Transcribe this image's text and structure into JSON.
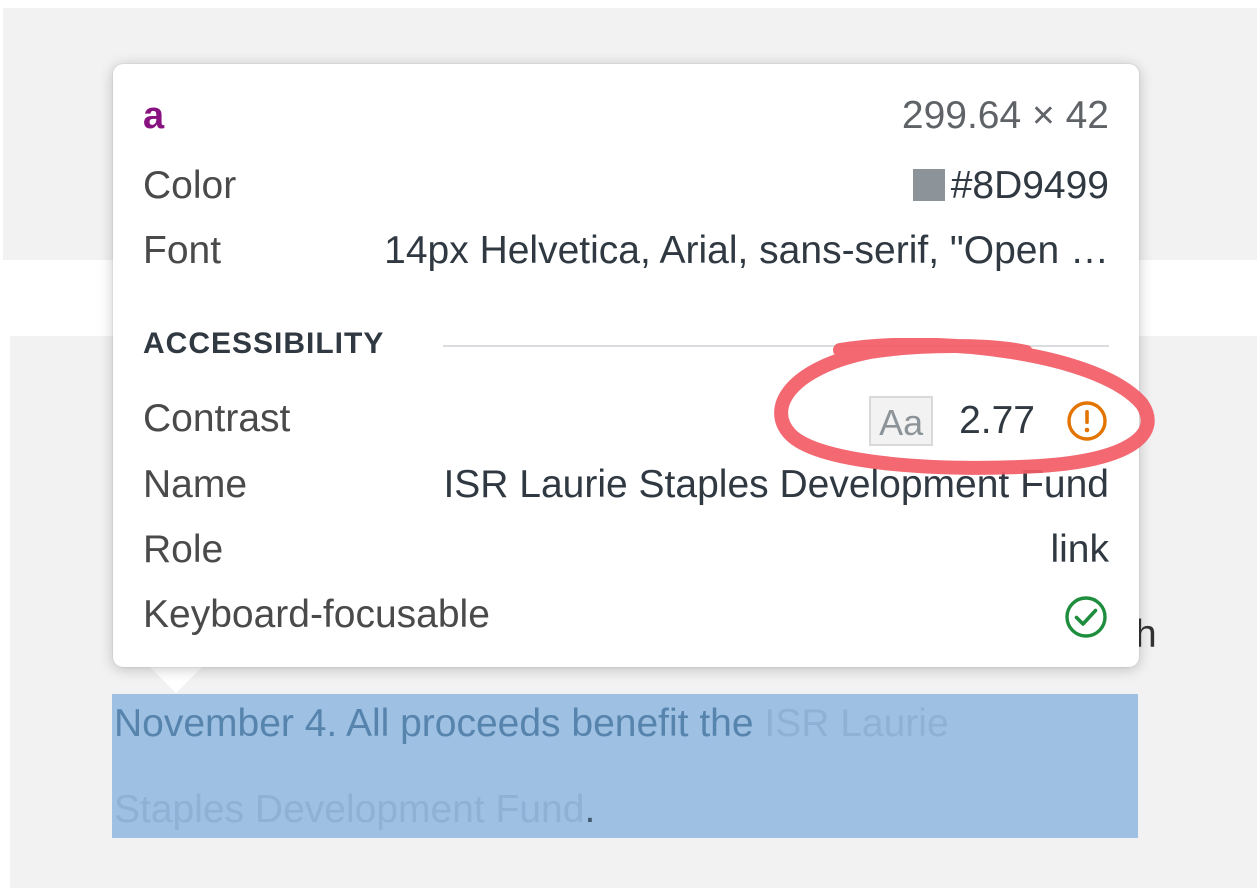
{
  "page": {
    "line1_text": "November 4. All proceeds benefit the ",
    "line1_link": "ISR Laurie",
    "line2_link": "Staples Development Fund",
    "line2_punct": ".",
    "stray_glyph": "h"
  },
  "tooltip": {
    "tag": "a",
    "dimensions": "299.64 × 42",
    "color_label": "Color",
    "color_value": "#8D9499",
    "font_label": "Font",
    "font_value": "14px Helvetica, Arial, sans-serif, \"Open …",
    "section_title": "ACCESSIBILITY",
    "contrast_label": "Contrast",
    "contrast_sample": "Aa",
    "contrast_ratio": "2.77",
    "contrast_status_icon": "warning-circle-icon",
    "name_label": "Name",
    "name_value": "ISR Laurie Staples Development Fund",
    "role_label": "Role",
    "role_value": "link",
    "focusable_label": "Keyboard-focusable",
    "focusable_status_icon": "check-circle-icon"
  },
  "colors": {
    "swatch": "#8D9499",
    "warning": "#E37400",
    "success": "#1E8E3E",
    "annotation": "#F25C66",
    "selection": "#9DC0E3"
  }
}
